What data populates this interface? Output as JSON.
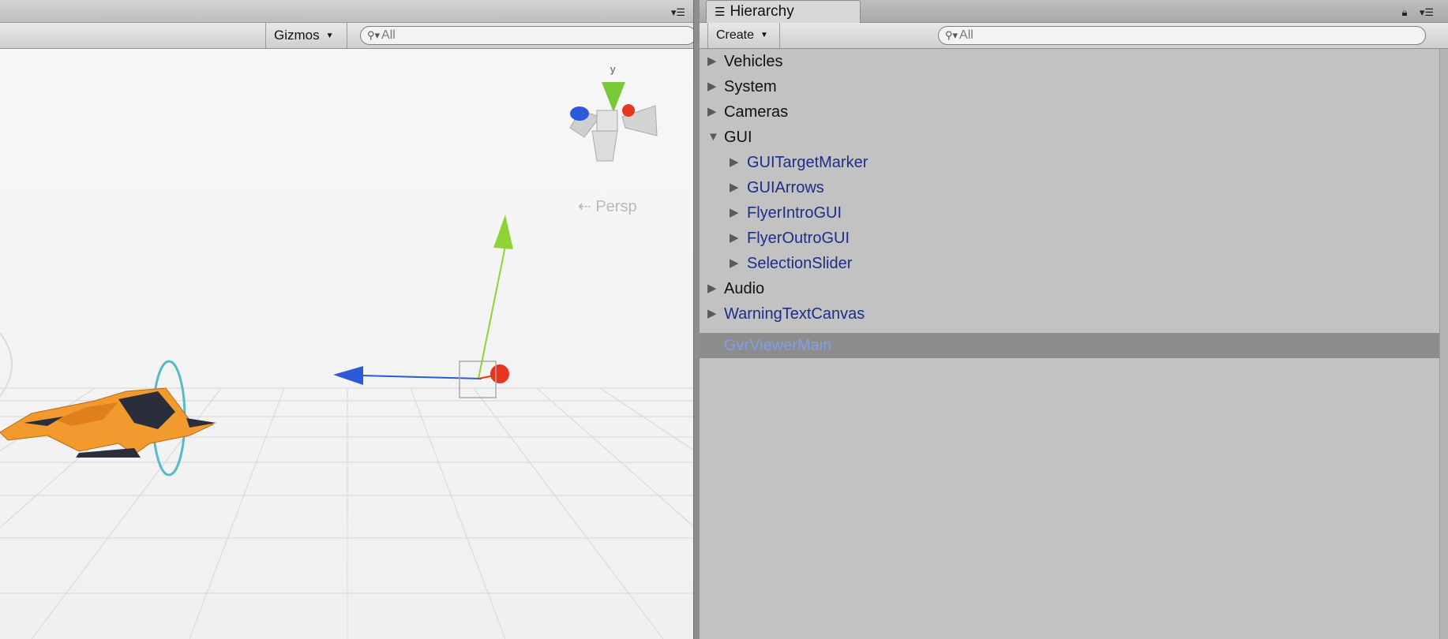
{
  "scene": {
    "gizmos_label": "Gizmos",
    "search_placeholder": "All",
    "persp_label": "Persp",
    "axis_y_label": "y"
  },
  "hierarchy": {
    "tab_title": "Hierarchy",
    "create_label": "Create",
    "search_placeholder": "All",
    "items": [
      {
        "label": "Vehicles",
        "expanded": false,
        "prefab": false
      },
      {
        "label": "System",
        "expanded": false,
        "prefab": false
      },
      {
        "label": "Cameras",
        "expanded": false,
        "prefab": false
      },
      {
        "label": "GUI",
        "expanded": true,
        "prefab": false
      },
      {
        "label": "GUITargetMarker",
        "expanded": false,
        "prefab": true
      },
      {
        "label": "GUIArrows",
        "expanded": false,
        "prefab": true
      },
      {
        "label": "FlyerIntroGUI",
        "expanded": false,
        "prefab": true
      },
      {
        "label": "FlyerOutroGUI",
        "expanded": false,
        "prefab": true
      },
      {
        "label": "SelectionSlider",
        "expanded": false,
        "prefab": true
      },
      {
        "label": "Audio",
        "expanded": false,
        "prefab": false
      },
      {
        "label": "WarningTextCanvas",
        "expanded": false,
        "prefab": true
      },
      {
        "label": "GvrViewerMain",
        "expanded": false,
        "prefab": true,
        "selected": true
      }
    ]
  },
  "colors": {
    "axis_x": "#e8351f",
    "axis_y": "#8fd336",
    "axis_z": "#2b5bd8",
    "ship_orange": "#f39a2e",
    "selection_row": "#8c8c8c",
    "prefab_text": "#1a2e8a"
  }
}
